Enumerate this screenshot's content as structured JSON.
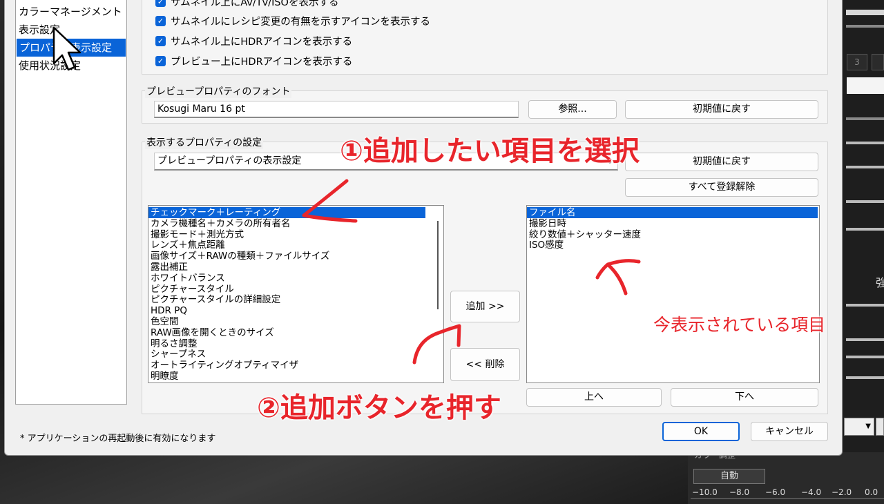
{
  "sidebar": {
    "items": [
      {
        "label": "カラーマネージメント",
        "selected": false
      },
      {
        "label": "表示設定",
        "selected": false
      },
      {
        "label": "プロパティ表示設定",
        "selected": true
      },
      {
        "label": "使用状況設定",
        "selected": false
      }
    ]
  },
  "checkboxes": [
    {
      "label": "サムネイル上にAv/Tv/ISOを表示する",
      "checked": true
    },
    {
      "label": "サムネイルにレシピ変更の有無を示すアイコンを表示する",
      "checked": true
    },
    {
      "label": "サムネイル上にHDRアイコンを表示する",
      "checked": true
    },
    {
      "label": "プレビュー上にHDRアイコンを表示する",
      "checked": true
    }
  ],
  "font_group": {
    "label": "プレビュープロパティのフォント",
    "value": "Kosugi Maru 16 pt",
    "browse_label": "参照...",
    "reset_label": "初期値に戻す"
  },
  "property_group": {
    "label": "表示するプロパティの設定",
    "combo_value": "プレビュープロパティの表示設定",
    "reset_label": "初期値に戻す",
    "unregister_all_label": "すべて登録解除"
  },
  "available_list": [
    {
      "label": "チェックマーク＋レーティング",
      "selected": true
    },
    {
      "label": "カメラ機種名＋カメラの所有者名",
      "selected": false
    },
    {
      "label": "撮影モード＋測光方式",
      "selected": false
    },
    {
      "label": "レンズ＋焦点距離",
      "selected": false
    },
    {
      "label": "画像サイズ＋RAWの種類＋ファイルサイズ",
      "selected": false
    },
    {
      "label": "露出補正",
      "selected": false
    },
    {
      "label": "ホワイトバランス",
      "selected": false
    },
    {
      "label": "ピクチャースタイル",
      "selected": false
    },
    {
      "label": "ピクチャースタイルの詳細設定",
      "selected": false
    },
    {
      "label": "HDR PQ",
      "selected": false
    },
    {
      "label": "色空間",
      "selected": false
    },
    {
      "label": "RAW画像を開くときのサイズ",
      "selected": false
    },
    {
      "label": "明るさ調整",
      "selected": false
    },
    {
      "label": "シャープネス",
      "selected": false
    },
    {
      "label": "オートライティングオプティマイザ",
      "selected": false
    },
    {
      "label": "明瞭度",
      "selected": false
    }
  ],
  "displayed_list": [
    {
      "label": "ファイル名",
      "selected": true
    },
    {
      "label": "撮影日時",
      "selected": false
    },
    {
      "label": "絞り数値＋シャッター速度",
      "selected": false
    },
    {
      "label": "ISO感度",
      "selected": false
    }
  ],
  "buttons": {
    "add": "追加 >>",
    "remove": "<< 削除",
    "up": "上へ",
    "down": "下へ",
    "ok": "OK",
    "cancel": "キャンセル"
  },
  "footnote": "* アプリケーションの再起動後に有効になります",
  "annotations": {
    "step1": "①追加したい項目を選択",
    "step2": "②追加ボタンを押す",
    "current": "今表示されている項目"
  },
  "background_app": {
    "tone_label": "カラー調整",
    "number_box": "3",
    "partial_char": "強",
    "auto_label": "自動",
    "scale": [
      "−10.0",
      "−8.0",
      "−6.0",
      "−4.0",
      "−2.0",
      "0.0"
    ]
  },
  "colors": {
    "accent": "#0a64d8",
    "annotation": "#e8252b"
  }
}
